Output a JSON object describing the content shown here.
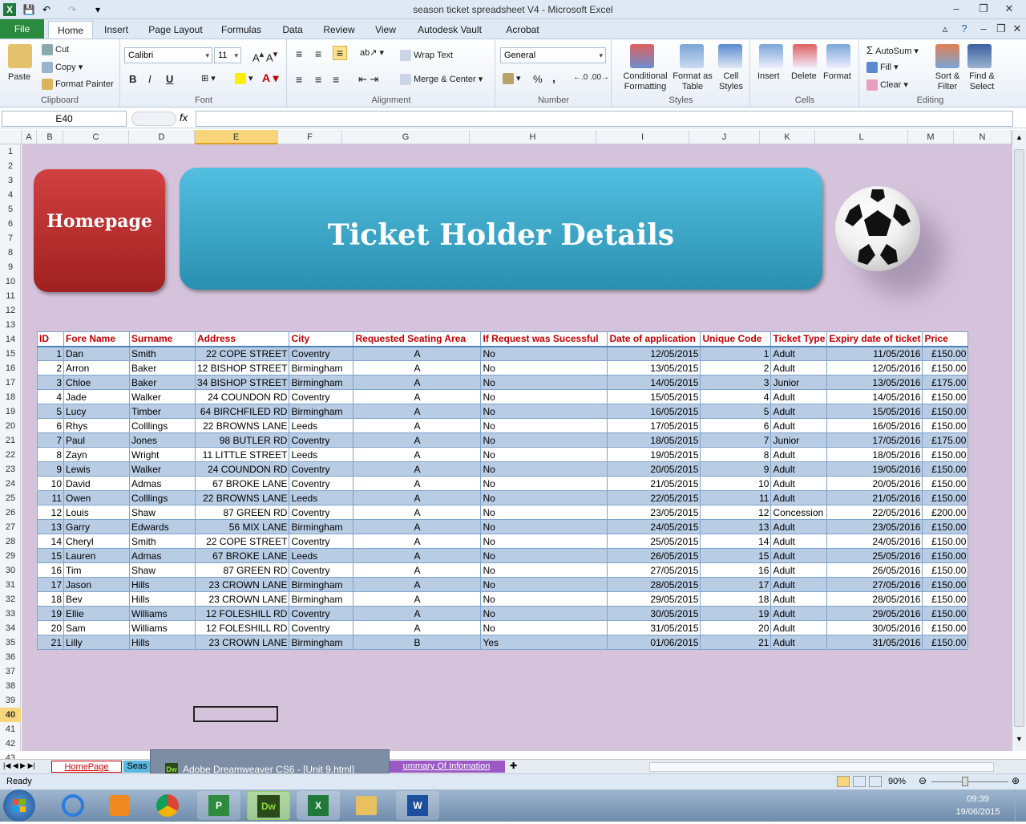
{
  "window": {
    "title": "season ticket spreadsheet V4  -  Microsoft Excel"
  },
  "ribbon_tabs": [
    "File",
    "Home",
    "Insert",
    "Page Layout",
    "Formulas",
    "Data",
    "Review",
    "View",
    "Autodesk Vault",
    "Acrobat"
  ],
  "clipboard": {
    "paste": "Paste",
    "cut": "Cut",
    "copy": "Copy",
    "format_painter": "Format Painter",
    "label": "Clipboard"
  },
  "font": {
    "name": "Calibri",
    "size": "11",
    "bold": "B",
    "italic": "I",
    "underline": "U",
    "label": "Font"
  },
  "alignment": {
    "wrap": "Wrap Text",
    "merge": "Merge & Center",
    "label": "Alignment"
  },
  "number": {
    "format": "General",
    "percent": "%",
    "comma": ",",
    "label": "Number"
  },
  "styles": {
    "conditional": "Conditional Formatting",
    "format_table": "Format as Table",
    "cell_styles": "Cell Styles",
    "label": "Styles"
  },
  "cells": {
    "insert": "Insert",
    "delete": "Delete",
    "format": "Format",
    "label": "Cells"
  },
  "editing": {
    "autosum": "AutoSum",
    "fill": "Fill",
    "clear": "Clear",
    "sort": "Sort & Filter",
    "find": "Find & Select",
    "label": "Editing"
  },
  "formula_bar": {
    "name_box": "E40",
    "fx": "fx",
    "formula": ""
  },
  "columns": [
    "A",
    "B",
    "C",
    "D",
    "E",
    "F",
    "G",
    "H",
    "I",
    "J",
    "K",
    "L",
    "M",
    "N"
  ],
  "selected_column": "E",
  "rows": [
    "1",
    "2",
    "3",
    "4",
    "5",
    "6",
    "7",
    "8",
    "9",
    "10",
    "11",
    "12",
    "13",
    "14",
    "15",
    "16",
    "17",
    "18",
    "19",
    "20",
    "21",
    "22",
    "23",
    "24",
    "25",
    "26",
    "27",
    "28",
    "29",
    "30",
    "31",
    "32",
    "33",
    "34",
    "35",
    "36",
    "37",
    "38",
    "39",
    "40",
    "41",
    "42",
    "43"
  ],
  "selected_row": "40",
  "sheet": {
    "homepage_button": "Homepage",
    "banner_title": "Ticket Holder Details"
  },
  "table": {
    "headers": [
      "ID",
      "Fore Name",
      "Surname",
      "Address",
      "City",
      "Requested Seating Area",
      "If Request was Sucessful",
      "Date of application",
      "Unique Code",
      "Ticket Type",
      "Expiry date of ticket",
      "Price"
    ],
    "rows": [
      [
        "1",
        "Dan",
        "Smith",
        "22 COPE STREET",
        "Coventry",
        "A",
        "No",
        "12/05/2015",
        "1",
        "Adult",
        "11/05/2016",
        "£150.00"
      ],
      [
        "2",
        "Arron",
        "Baker",
        "12 BISHOP STREET",
        "Birmingham",
        "A",
        "No",
        "13/05/2015",
        "2",
        "Adult",
        "12/05/2016",
        "£150.00"
      ],
      [
        "3",
        "Chloe",
        "Baker",
        "34 BISHOP STREET",
        "Birmingham",
        "A",
        "No",
        "14/05/2015",
        "3",
        "Junior",
        "13/05/2016",
        "£175.00"
      ],
      [
        "4",
        "Jade",
        "Walker",
        "24 COUNDON RD",
        "Coventry",
        "A",
        "No",
        "15/05/2015",
        "4",
        "Adult",
        "14/05/2016",
        "£150.00"
      ],
      [
        "5",
        "Lucy",
        "Timber",
        "64 BIRCHFILED RD",
        "Birmingham",
        "A",
        "No",
        "16/05/2015",
        "5",
        "Adult",
        "15/05/2016",
        "£150.00"
      ],
      [
        "6",
        "Rhys",
        "Colllings",
        "22 BROWNS LANE",
        "Leeds",
        "A",
        "No",
        "17/05/2015",
        "6",
        "Adult",
        "16/05/2016",
        "£150.00"
      ],
      [
        "7",
        "Paul",
        "Jones",
        "98 BUTLER RD",
        "Coventry",
        "A",
        "No",
        "18/05/2015",
        "7",
        "Junior",
        "17/05/2016",
        "£175.00"
      ],
      [
        "8",
        "Zayn",
        "Wright",
        "11 LITTLE STREET",
        "Leeds",
        "A",
        "No",
        "19/05/2015",
        "8",
        "Adult",
        "18/05/2016",
        "£150.00"
      ],
      [
        "9",
        "Lewis",
        "Walker",
        "24 COUNDON RD",
        "Coventry",
        "A",
        "No",
        "20/05/2015",
        "9",
        "Adult",
        "19/05/2016",
        "£150.00"
      ],
      [
        "10",
        "David",
        "Admas",
        "67 BROKE LANE",
        "Coventry",
        "A",
        "No",
        "21/05/2015",
        "10",
        "Adult",
        "20/05/2016",
        "£150.00"
      ],
      [
        "11",
        "Owen",
        "Colllings",
        "22 BROWNS LANE",
        "Leeds",
        "A",
        "No",
        "22/05/2015",
        "11",
        "Adult",
        "21/05/2016",
        "£150.00"
      ],
      [
        "12",
        "Louis",
        "Shaw",
        "87 GREEN RD",
        "Coventry",
        "A",
        "No",
        "23/05/2015",
        "12",
        "Concession",
        "22/05/2016",
        "£200.00"
      ],
      [
        "13",
        "Garry",
        "Edwards",
        "56 MIX LANE",
        "Birmingham",
        "A",
        "No",
        "24/05/2015",
        "13",
        "Adult",
        "23/05/2016",
        "£150.00"
      ],
      [
        "14",
        "Cheryl",
        "Smith",
        "22 COPE STREET",
        "Coventry",
        "A",
        "No",
        "25/05/2015",
        "14",
        "Adult",
        "24/05/2016",
        "£150.00"
      ],
      [
        "15",
        "Lauren",
        "Admas",
        "67 BROKE LANE",
        "Leeds",
        "A",
        "No",
        "26/05/2015",
        "15",
        "Adult",
        "25/05/2016",
        "£150.00"
      ],
      [
        "16",
        "Tim",
        "Shaw",
        "87 GREEN RD",
        "Coventry",
        "A",
        "No",
        "27/05/2015",
        "16",
        "Adult",
        "26/05/2016",
        "£150.00"
      ],
      [
        "17",
        "Jason",
        "Hills",
        "23 CROWN LANE",
        "Birmingham",
        "A",
        "No",
        "28/05/2015",
        "17",
        "Adult",
        "27/05/2016",
        "£150.00"
      ],
      [
        "18",
        "Bev",
        "Hills",
        "23 CROWN LANE",
        "Birmingham",
        "A",
        "No",
        "29/05/2015",
        "18",
        "Adult",
        "28/05/2016",
        "£150.00"
      ],
      [
        "19",
        "Ellie",
        "Williams",
        "12 FOLESHILL RD",
        "Coventry",
        "A",
        "No",
        "30/05/2015",
        "19",
        "Adult",
        "29/05/2016",
        "£150.00"
      ],
      [
        "20",
        "Sam",
        "Williams",
        "12 FOLESHILL RD",
        "Coventry",
        "A",
        "No",
        "31/05/2015",
        "20",
        "Adult",
        "30/05/2016",
        "£150.00"
      ],
      [
        "21",
        "Lilly",
        "Hills",
        "23 CROWN LANE",
        "Birmingham",
        "B",
        "Yes",
        "01/06/2015",
        "21",
        "Adult",
        "31/05/2016",
        "£150.00"
      ]
    ]
  },
  "sheet_tabs": [
    "HomePage",
    "Seas",
    "ummary Of Infomation"
  ],
  "taskbar_popup": "Adobe Dreamweaver CS6 - [Unit 9.html]",
  "status": {
    "ready": "Ready",
    "zoom": "90%"
  },
  "clock": {
    "time": "09:39",
    "date": "19/06/2015"
  },
  "colors": {
    "header_text": "#c00000",
    "band": "#b8cce4",
    "sheet_bg": "#d5c3dc",
    "banner": "#3aaed0",
    "home_button": "#c23030",
    "file_tab": "#2a8a3e"
  }
}
